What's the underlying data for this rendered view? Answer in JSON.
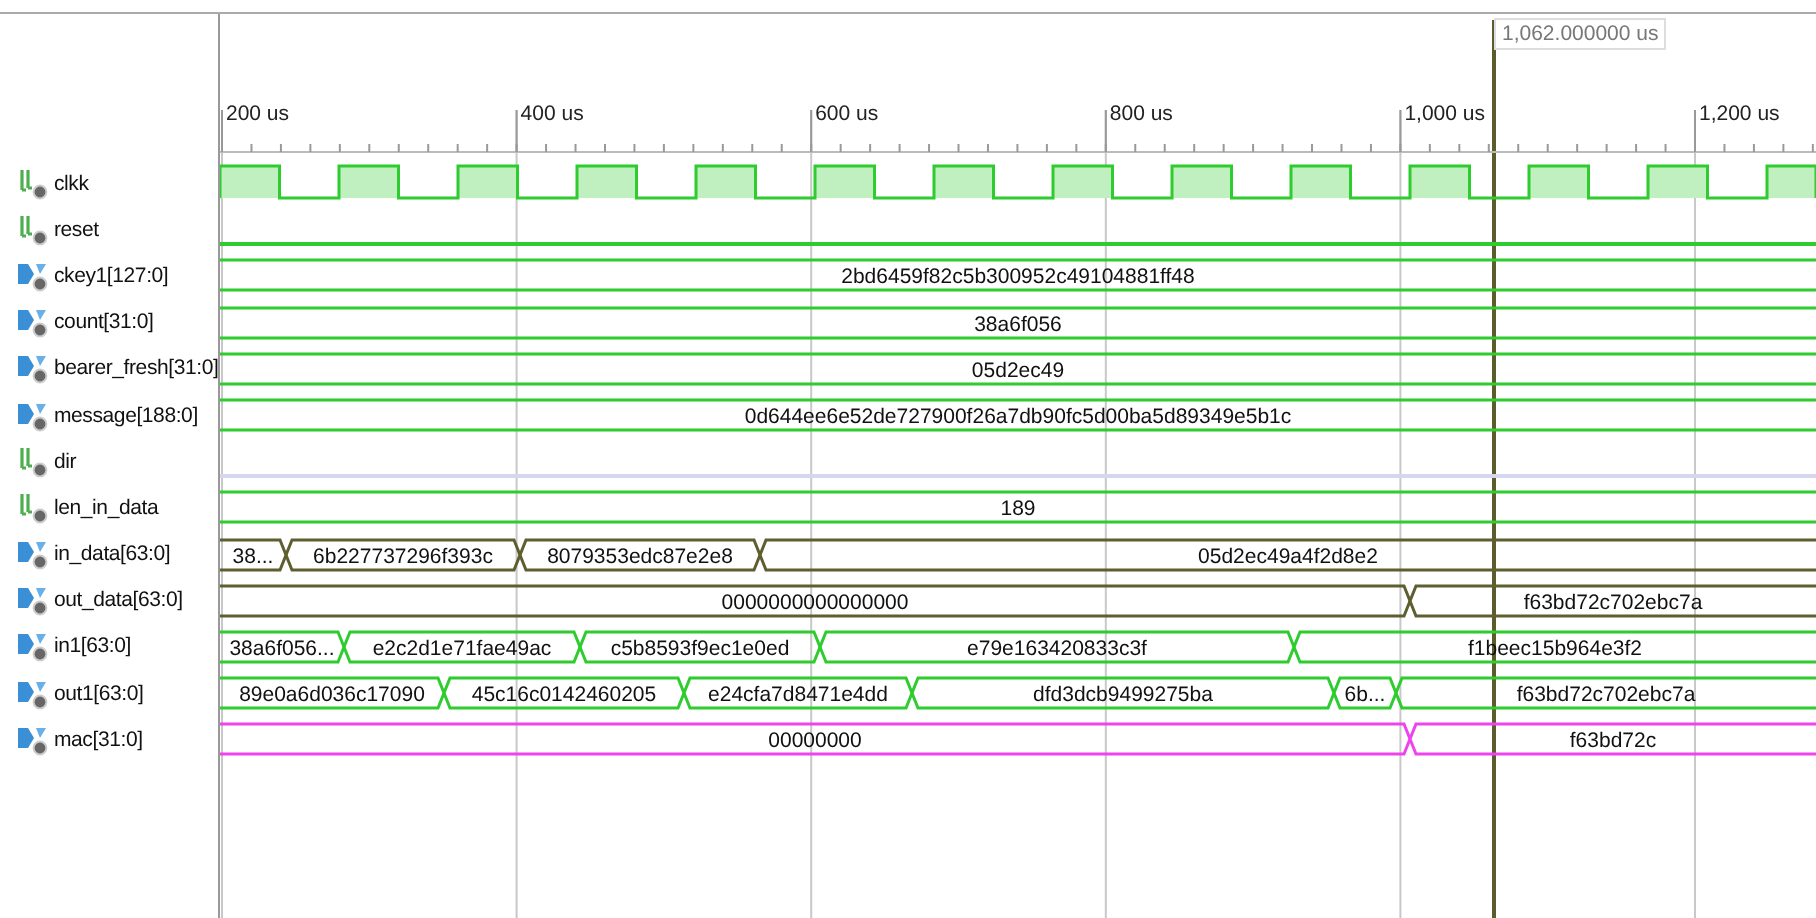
{
  "cursor": {
    "label": "1,062.000000 us"
  },
  "ruler": {
    "ticks": [
      "200 us",
      "400 us",
      "600 us",
      "800 us",
      "1,000 us",
      "1,200 us"
    ]
  },
  "signals": [
    {
      "name": "clkk",
      "kind": "clock",
      "color": "#2ecc2e"
    },
    {
      "name": "reset",
      "kind": "low",
      "color": "#2ecc2e"
    },
    {
      "name": "ckey1[127:0]",
      "kind": "bus",
      "color": "#2ecc2e",
      "values": [
        "2bd6459f82c5b300952c49104881ff48"
      ]
    },
    {
      "name": "count[31:0]",
      "kind": "bus",
      "color": "#2ecc2e",
      "values": [
        "38a6f056"
      ]
    },
    {
      "name": "bearer_fresh[31:0]",
      "kind": "bus",
      "color": "#2ecc2e",
      "values": [
        "05d2ec49"
      ]
    },
    {
      "name": "message[188:0]",
      "kind": "bus",
      "color": "#2ecc2e",
      "values": [
        "0d644ee6e52de727900f26a7db90fc5d00ba5d89349e5b1c"
      ]
    },
    {
      "name": "dir",
      "kind": "low",
      "color": "#d6d6f0"
    },
    {
      "name": "len_in_data",
      "kind": "int",
      "color": "#2ecc2e",
      "values": [
        "189"
      ]
    },
    {
      "name": "in_data[63:0]",
      "kind": "bus",
      "color": "#5e5e30",
      "values": [
        "38...",
        "6b227737296f393c",
        "8079353edc87e2e8",
        "05d2ec49a4f2d8e2"
      ]
    },
    {
      "name": "out_data[63:0]",
      "kind": "bus",
      "color": "#5e5e30",
      "values": [
        "0000000000000000",
        "f63bd72c702ebc7a"
      ]
    },
    {
      "name": "in1[63:0]",
      "kind": "bus",
      "color": "#2ecc2e",
      "values": [
        "38a6f056...",
        "e2c2d1e71fae49ac",
        "c5b8593f9ec1e0ed",
        "e79e163420833c3f",
        "f1beec15b964e3f2"
      ]
    },
    {
      "name": "out1[63:0]",
      "kind": "bus",
      "color": "#2ecc2e",
      "values": [
        "89e0a6d036c17090",
        "45c16c0142460205",
        "e24cfa7d8471e4dd",
        "dfd3dcb9499275ba",
        "6b...",
        "f63bd72c702ebc7a"
      ]
    },
    {
      "name": "mac[31:0]",
      "kind": "bus",
      "color": "#ee44ee",
      "values": [
        "00000000",
        "f63bd72c"
      ]
    }
  ]
}
